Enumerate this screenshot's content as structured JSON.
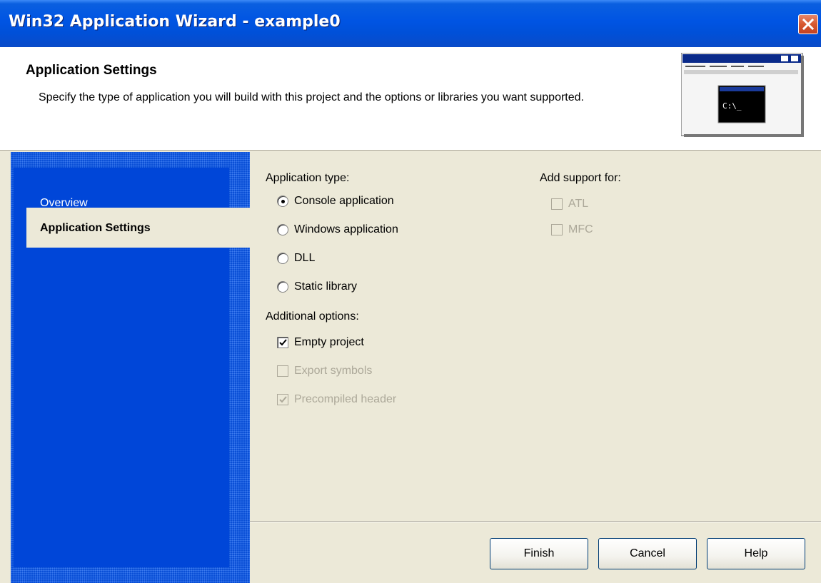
{
  "window": {
    "title": "Win32 Application Wizard - example0"
  },
  "header": {
    "title": "Application Settings",
    "description": "Specify the type of application you will build with this project and the options or libraries you want supported.",
    "thumbnail_text": "C:\\_"
  },
  "nav": {
    "items": [
      {
        "label": "Overview",
        "selected": false
      },
      {
        "label": "Application Settings",
        "selected": true
      }
    ]
  },
  "application_type": {
    "label": "Application type:",
    "options": [
      {
        "label": "Console application",
        "selected": true
      },
      {
        "label": "Windows application",
        "selected": false
      },
      {
        "label": "DLL",
        "selected": false
      },
      {
        "label": "Static library",
        "selected": false
      }
    ]
  },
  "additional_options": {
    "label": "Additional options:",
    "options": [
      {
        "label": "Empty project",
        "checked": true,
        "enabled": true
      },
      {
        "label": "Export symbols",
        "checked": false,
        "enabled": false
      },
      {
        "label": "Precompiled header",
        "checked": true,
        "enabled": false
      }
    ]
  },
  "add_support": {
    "label": "Add support for:",
    "options": [
      {
        "label": "ATL",
        "checked": false,
        "enabled": false
      },
      {
        "label": "MFC",
        "checked": false,
        "enabled": false
      }
    ]
  },
  "buttons": {
    "finish": "Finish",
    "cancel": "Cancel",
    "help": "Help"
  },
  "colors": {
    "titlebar": "#0054e3",
    "nav_background": "#0a4fd6",
    "dialog_face": "#ece9d8",
    "close_button": "#d75830"
  },
  "icons": {
    "close": "close-icon",
    "wizard_thumbnail": "console-window-icon"
  }
}
